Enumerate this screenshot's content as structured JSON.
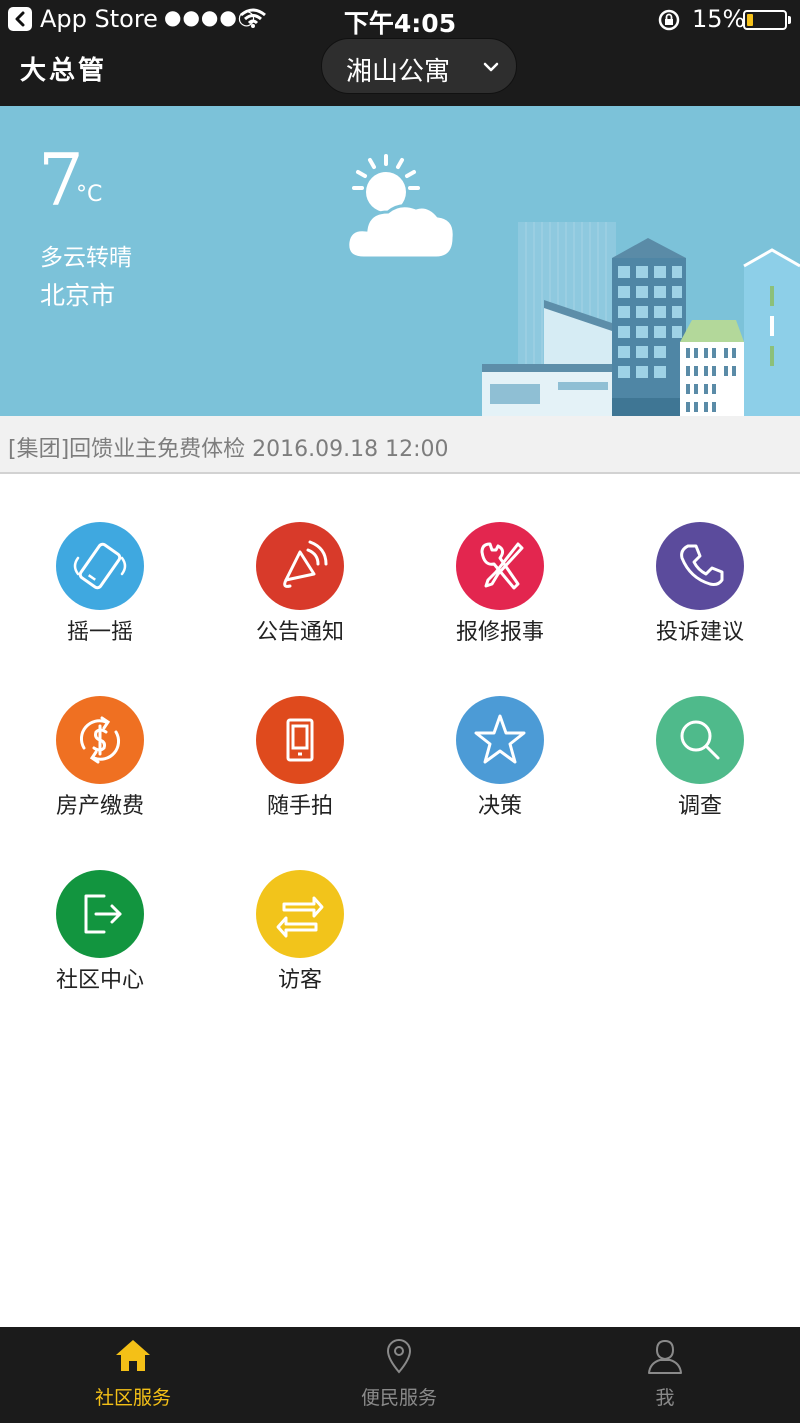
{
  "status_bar": {
    "carrier": "App Store",
    "signal": "●●●●○",
    "time": "下午4:05",
    "battery": "15%"
  },
  "header": {
    "logo": "大总管",
    "community": "湘山公寓"
  },
  "weather": {
    "temperature": "7",
    "unit": "°C",
    "condition": "多云转晴",
    "city": "北京市"
  },
  "ticker": {
    "text": "[集团]回馈业主免费体检 2016.09.18 12:00"
  },
  "services": [
    {
      "label": "摇一摇",
      "icon": "shake-phone-icon",
      "color": "#3fa8e0"
    },
    {
      "label": "公告通知",
      "icon": "megaphone-icon",
      "color": "#d83a2a"
    },
    {
      "label": "报修报事",
      "icon": "tools-icon",
      "color": "#e3264f"
    },
    {
      "label": "投诉建议",
      "icon": "phone-icon",
      "color": "#5b4b9c"
    },
    {
      "label": "房产缴费",
      "icon": "dollar-refresh-icon",
      "color": "#ef7022"
    },
    {
      "label": "随手拍",
      "icon": "mobile-camera-icon",
      "color": "#df4a1d"
    },
    {
      "label": "决策",
      "icon": "star-icon",
      "color": "#4c9bd6"
    },
    {
      "label": "调查",
      "icon": "search-icon",
      "color": "#4fba8b"
    },
    {
      "label": "社区中心",
      "icon": "exit-door-icon",
      "color": "#12953f"
    },
    {
      "label": "访客",
      "icon": "swap-arrows-icon",
      "color": "#f2c41b"
    }
  ],
  "tabbar": {
    "items": [
      {
        "label": "社区服务",
        "icon": "home-icon",
        "active": true
      },
      {
        "label": "便民服务",
        "icon": "location-pin-icon",
        "active": false
      },
      {
        "label": "我",
        "icon": "user-icon",
        "active": false
      }
    ]
  }
}
